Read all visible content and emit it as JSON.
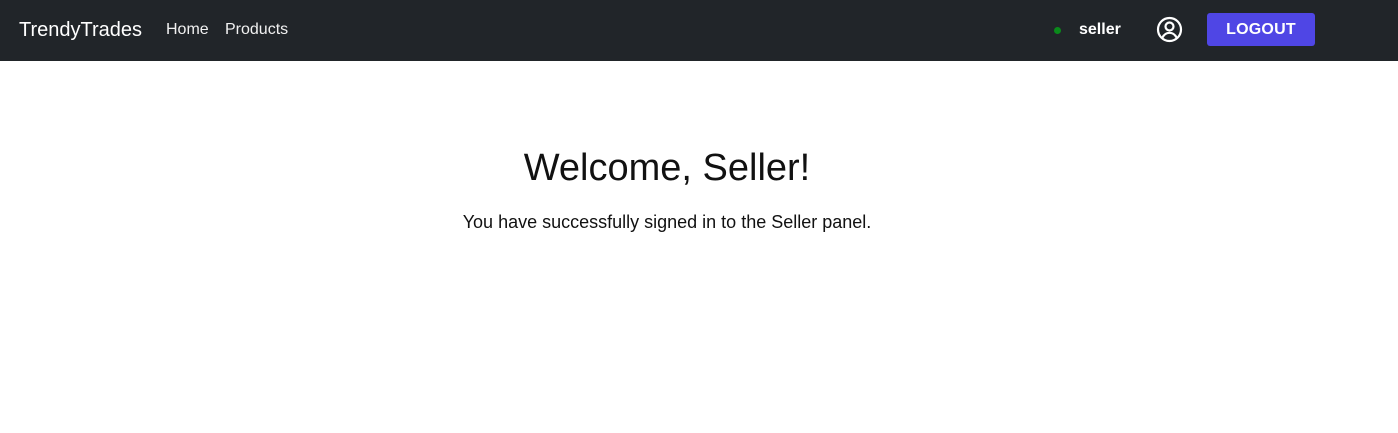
{
  "navbar": {
    "brand": "TrendyTrades",
    "links": [
      {
        "label": "Home"
      },
      {
        "label": "Products"
      }
    ],
    "user": {
      "status_color": "#0a8a1b",
      "username": "seller",
      "profile_icon": "user-circle-icon"
    },
    "logout_label": "LOGOUT",
    "logout_color": "#4f46e5",
    "background": "#212529"
  },
  "main": {
    "title": "Welcome, Seller!",
    "message": "You have successfully signed in to the Seller panel."
  }
}
